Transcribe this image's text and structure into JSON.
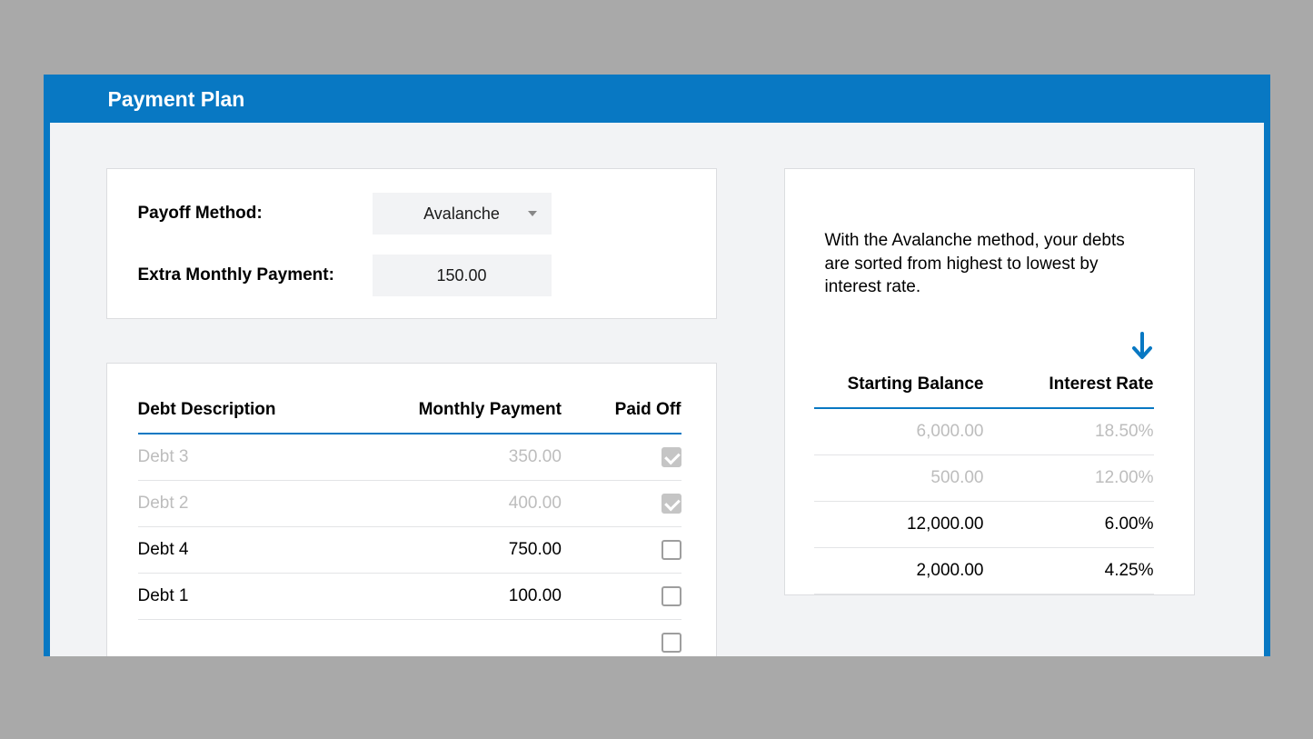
{
  "header": {
    "title": "Payment Plan"
  },
  "settings": {
    "payoff_label": "Payoff Method:",
    "payoff_value": "Avalanche",
    "extra_label": "Extra Monthly Payment:",
    "extra_value": "150.00"
  },
  "info": {
    "text": "With the Avalanche method, your debts are sorted from highest to lowest by interest rate."
  },
  "left_table": {
    "headers": {
      "desc": "Debt Description",
      "monthly": "Monthly Payment",
      "paid": "Paid Off"
    },
    "rows": [
      {
        "desc": "Debt 3",
        "monthly": "350.00",
        "paid": true
      },
      {
        "desc": "Debt 2",
        "monthly": "400.00",
        "paid": true
      },
      {
        "desc": "Debt 4",
        "monthly": "750.00",
        "paid": false
      },
      {
        "desc": "Debt 1",
        "monthly": "100.00",
        "paid": false
      }
    ]
  },
  "right_table": {
    "headers": {
      "balance": "Starting Balance",
      "rate": "Interest Rate"
    },
    "rows": [
      {
        "balance": "6,000.00",
        "rate": "18.50%",
        "paid": true
      },
      {
        "balance": "500.00",
        "rate": "12.00%",
        "paid": true
      },
      {
        "balance": "12,000.00",
        "rate": "6.00%",
        "paid": false
      },
      {
        "balance": "2,000.00",
        "rate": "4.25%",
        "paid": false
      }
    ]
  },
  "colors": {
    "accent": "#0878c3"
  }
}
